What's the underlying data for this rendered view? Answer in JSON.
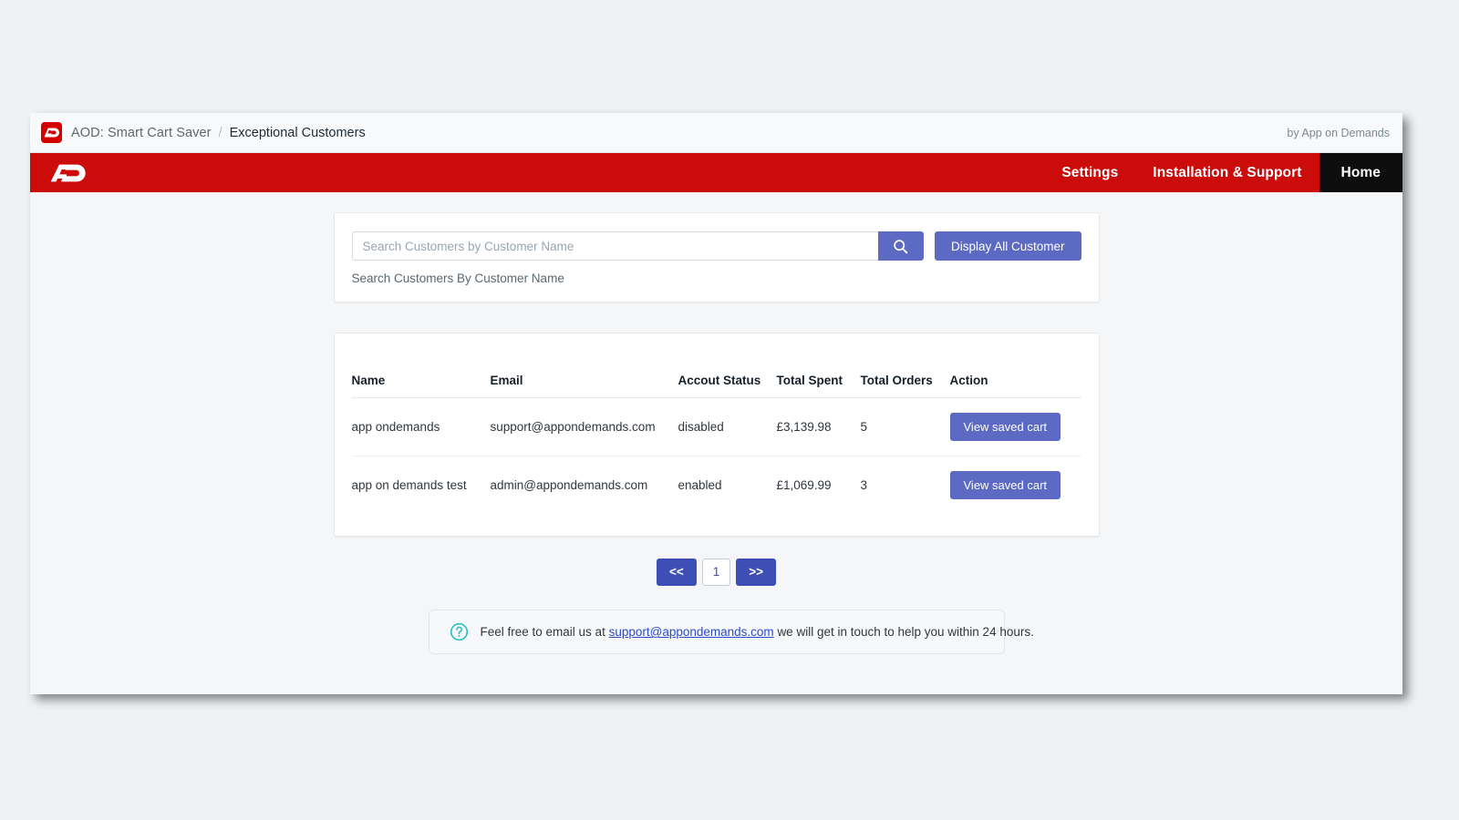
{
  "breadcrumb": {
    "logo_icon": "aod-logo-icon",
    "app_name": "AOD: Smart Cart Saver",
    "separator": "/",
    "page": "Exceptional Customers",
    "by_line": "by App on Demands"
  },
  "navbar": {
    "brand_icon": "aod-wordmark-icon",
    "links": [
      {
        "label": "Settings",
        "active": false
      },
      {
        "label": "Installation & Support",
        "active": false
      },
      {
        "label": "Home",
        "active": true
      }
    ]
  },
  "search": {
    "placeholder": "Search Customers by Customer Name",
    "value": "",
    "search_icon": "search-icon",
    "display_all_label": "Display All Customer",
    "help_text": "Search Customers By Customer Name"
  },
  "table": {
    "columns": [
      "Name",
      "Email",
      "Accout Status",
      "Total Spent",
      "Total Orders",
      "Action"
    ],
    "rows": [
      {
        "name": "app ondemands",
        "email": "support@appondemands.com",
        "status": "disabled",
        "total_spent": "£3,139.98",
        "total_orders": "5",
        "action_label": "View saved cart"
      },
      {
        "name": "app on demands test",
        "email": "admin@appondemands.com",
        "status": "enabled",
        "total_spent": "£1,069.99",
        "total_orders": "3",
        "action_label": "View saved cart"
      }
    ]
  },
  "pagination": {
    "prev_label": "<<",
    "current_page": "1",
    "next_label": ">>"
  },
  "footer": {
    "help_icon": "question-circle-icon",
    "text_before": "Feel free to email us at",
    "email": "support@appondemands.com",
    "text_after": "we will get in touch to help you within 24 hours."
  },
  "colors": {
    "brand_red": "#cc0b0b",
    "accent_indigo": "#5c6ac4",
    "pagination_indigo": "#3d4fb5",
    "active_tab_black": "#0d0d0d",
    "help_teal": "#2cc0bf",
    "link_blue": "#2b4acb",
    "page_background": "#f4f6f8"
  }
}
